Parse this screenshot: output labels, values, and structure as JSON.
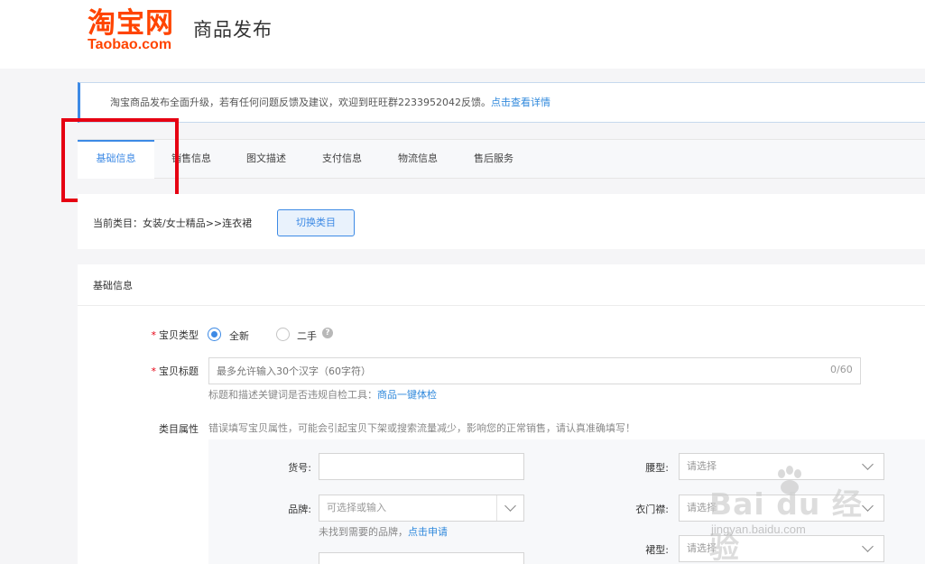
{
  "header": {
    "logo_cn": "淘宝网",
    "logo_en": "Taobao.com",
    "title": "商品发布"
  },
  "notice": {
    "text": "淘宝商品发布全面升级，若有任何问题反馈及建议，欢迎到旺旺群2233952042反馈。",
    "link": "点击查看详情"
  },
  "tabs": [
    {
      "label": "基础信息",
      "active": true
    },
    {
      "label": "销售信息"
    },
    {
      "label": "图文描述"
    },
    {
      "label": "支付信息"
    },
    {
      "label": "物流信息"
    },
    {
      "label": "售后服务"
    }
  ],
  "category": {
    "current": "当前类目：女装/女士精品>>连衣裙",
    "switch_button": "切换类目"
  },
  "section": {
    "title": "基础信息",
    "item_type": {
      "label": "宝贝类型",
      "options": [
        {
          "label": "全新",
          "checked": true
        },
        {
          "label": "二手",
          "checked": false
        }
      ]
    },
    "item_title": {
      "label": "宝贝标题",
      "placeholder": "最多允许输入30个汉字（60字符）",
      "counter": "0/60",
      "hint": "标题和描述关键词是否违规自检工具：",
      "hint_link": "商品一键体检"
    },
    "attributes": {
      "label": "类目属性",
      "warning": "错误填写宝贝属性，可能会引起宝贝下架或搜索流量减少，影响您的正常销售，请认真准确填写！",
      "fields": {
        "item_no": {
          "label": "货号:",
          "value": ""
        },
        "brand": {
          "label": "品牌:",
          "placeholder": "可选择或输入",
          "hint": "未找到需要的品牌，",
          "hint_link": "点击申请"
        },
        "waist": {
          "label": "腰型:",
          "placeholder": "请选择"
        },
        "placket": {
          "label": "衣门襟:",
          "placeholder": "请选择"
        },
        "skirt_type": {
          "label": "裙型:",
          "placeholder": "请选择"
        }
      }
    }
  },
  "watermark": {
    "main": "Bai du 经验",
    "url": "jingyan.baidu.com"
  },
  "colors": {
    "brand": "#ff4400",
    "accent": "#3d8ae5",
    "highlight": "#e60012"
  }
}
